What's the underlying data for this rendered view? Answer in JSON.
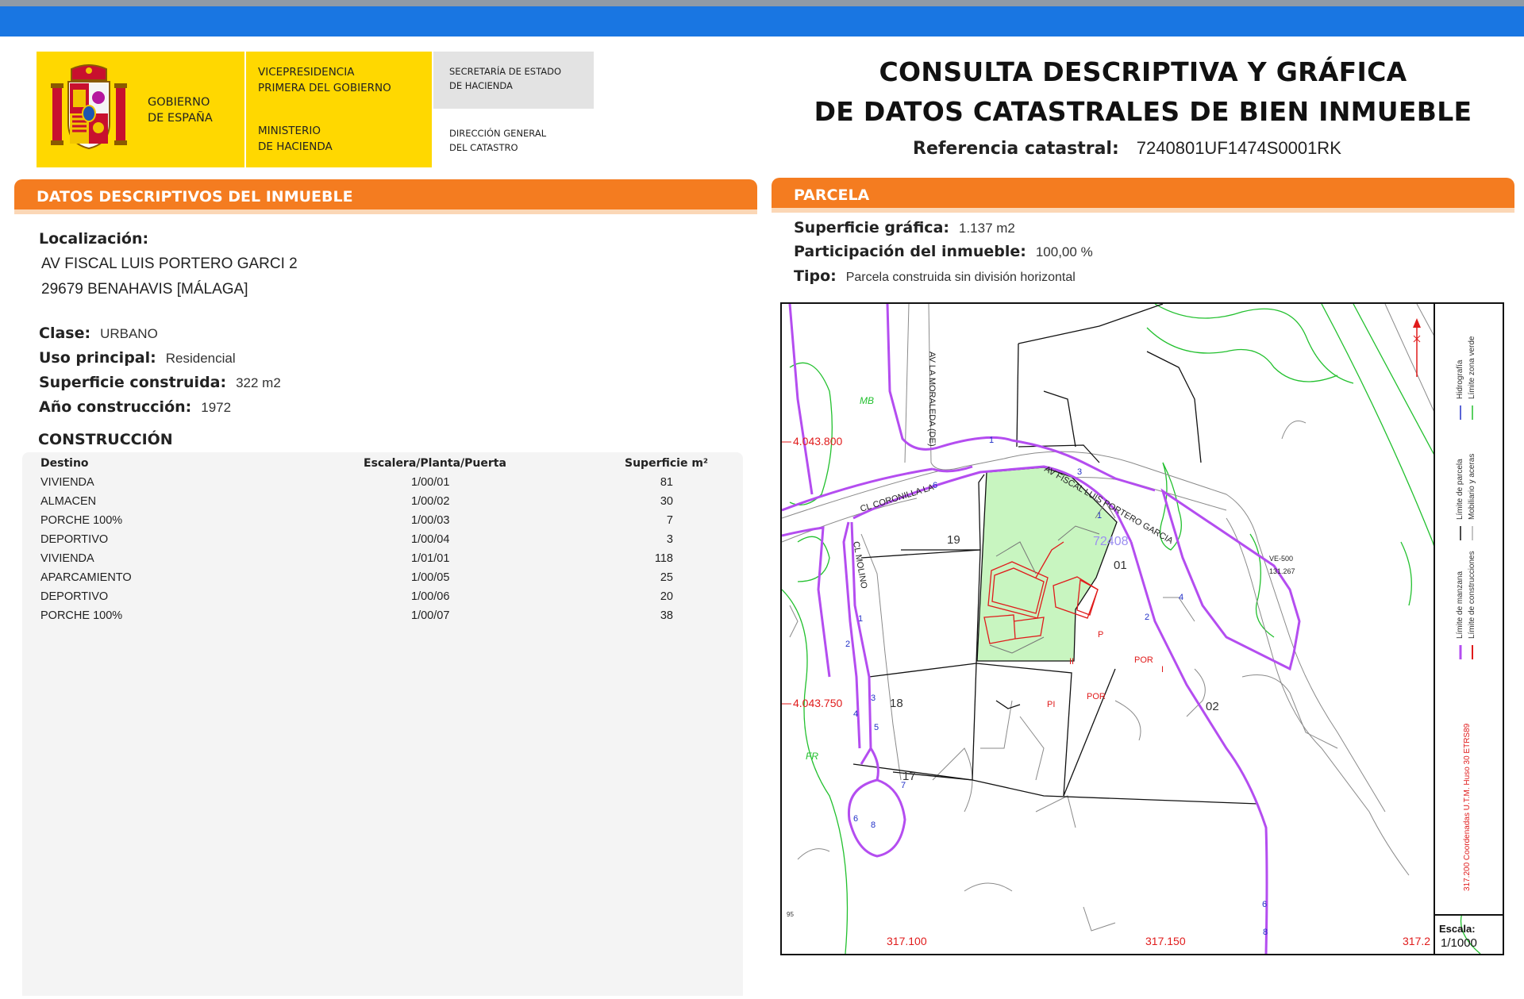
{
  "header": {
    "logo": {
      "gobierno": [
        "GOBIERNO",
        "DE ESPAÑA"
      ],
      "vicepresidencia": [
        "VICEPRESIDENCIA",
        "PRIMERA DEL GOBIERNO"
      ],
      "ministerio": [
        "MINISTERIO",
        "DE HACIENDA"
      ],
      "secretaria": [
        "SECRETARÍA DE ESTADO",
        "DE HACIENDA"
      ],
      "direccion": [
        "DIRECCIÓN GENERAL",
        "DEL CATASTRO"
      ]
    },
    "title_line1": "CONSULTA DESCRIPTIVA Y GRÁFICA",
    "title_line2": "DE DATOS CATASTRALES DE BIEN INMUEBLE",
    "ref_label": "Referencia catastral:",
    "ref_value": "7240801UF1474S0001RK"
  },
  "left_panel": {
    "heading": "DATOS DESCRIPTIVOS DEL INMUEBLE",
    "localizacion_label": "Localización:",
    "address_line1": "AV FISCAL LUIS PORTERO GARCI 2",
    "address_line2": "29679 BENAHAVIS [MÁLAGA]",
    "clase_label": "Clase:",
    "clase_value": "URBANO",
    "uso_label": "Uso principal:",
    "uso_value": "Residencial",
    "superficie_label": "Superficie construida:",
    "superficie_value": "322 m2",
    "anio_label": "Año construcción:",
    "anio_value": "1972",
    "construccion_heading": "CONSTRUCCIÓN",
    "table": {
      "headers": [
        "Destino",
        "Escalera/Planta/Puerta",
        "Superficie m²"
      ],
      "rows": [
        [
          "VIVIENDA",
          "1/00/01",
          "81"
        ],
        [
          "ALMACEN",
          "1/00/02",
          "30"
        ],
        [
          "PORCHE 100%",
          "1/00/03",
          "7"
        ],
        [
          "DEPORTIVO",
          "1/00/04",
          "3"
        ],
        [
          "VIVIENDA",
          "1/01/01",
          "118"
        ],
        [
          "APARCAMIENTO",
          "1/00/05",
          "25"
        ],
        [
          "DEPORTIVO",
          "1/00/06",
          "20"
        ],
        [
          "PORCHE 100%",
          "1/00/07",
          "38"
        ]
      ]
    }
  },
  "right_panel": {
    "heading": "PARCELA",
    "superficie_label": "Superficie gráfica:",
    "superficie_value": "1.137 m2",
    "participacion_label": "Participación del inmueble:",
    "participacion_value": "100,00 %",
    "tipo_label": "Tipo:",
    "tipo_value": "Parcela construida sin división horizontal"
  },
  "map": {
    "coords": {
      "y1": "4.043.800",
      "y2": "4.043.750",
      "x1": "317.100",
      "x2": "317.150",
      "x3": "317.2"
    },
    "streets": {
      "moraleda": "AV LA MORALEDA (DE)",
      "coronilla": "CL CORONILLA LA",
      "fiscal": "AV FISCAL LUIS PORTERO GARCIA",
      "molino": "CL MOLINO"
    },
    "parcels": {
      "p01": "01",
      "p02": "02",
      "p17": "17",
      "p18": "18",
      "p19": "19",
      "p7240": "72408"
    },
    "tags": {
      "mb": "MB",
      "fr": "FR",
      "ve": "VE-500",
      "ve_val": "131.267",
      "p": "P",
      "ii": "II",
      "por1": "POR",
      "i": "I",
      "pi": "PI",
      "por2": "POR",
      "small": "95"
    },
    "house_numbers": [
      "1",
      "3",
      "1",
      "2",
      "4",
      "6",
      "1",
      "2",
      "3",
      "4",
      "5",
      "7",
      "8",
      "6",
      "6",
      "8"
    ],
    "legend": {
      "limite_manzana": "Límite de manzana",
      "limite_construcciones": "Límite de construcciones",
      "limite_parcela": "Límite de parcela",
      "mobiliario": "Mobiliario y aceras",
      "hidrografia": "Hidrografía",
      "zona_verde": "Límite zona verde",
      "coordenadas": "317.200 Coordenadas U.T.M. Huso 30 ETRS89"
    },
    "scale_label": "Escala:",
    "scale_value": "1/1000",
    "colors": {
      "block_limit": "#b44df0",
      "construction": "#e01b1b",
      "green_zone": "#22c02e",
      "parcel_fill": "#c8f5c0"
    }
  }
}
